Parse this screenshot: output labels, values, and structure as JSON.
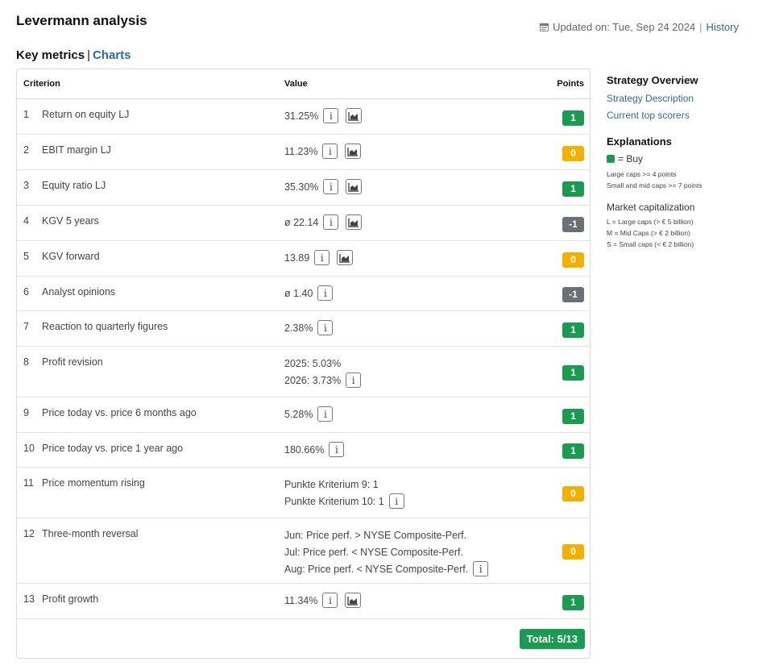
{
  "header": {
    "title": "Levermann analysis",
    "updated": "Updated on: Tue, Sep 24 2024",
    "separator": "|",
    "history": "History"
  },
  "subheader": {
    "key_metrics": "Key metrics",
    "separator": "|",
    "charts": "Charts"
  },
  "table": {
    "headers": {
      "criterion": "Criterion",
      "value": "Value",
      "points": "Points"
    },
    "rows": [
      {
        "num": "1",
        "label": "Return on equity LJ",
        "lines": [
          "31.25%"
        ],
        "chart": true,
        "points": "1",
        "color": "green"
      },
      {
        "num": "2",
        "label": "EBIT margin LJ",
        "lines": [
          "11.23%"
        ],
        "chart": true,
        "points": "0",
        "color": "yellow"
      },
      {
        "num": "3",
        "label": "Equity ratio LJ",
        "lines": [
          "35.30%"
        ],
        "chart": true,
        "points": "1",
        "color": "green"
      },
      {
        "num": "4",
        "label": "KGV 5 years",
        "lines": [
          "ø 22.14"
        ],
        "chart": true,
        "points": "-1",
        "color": "gray"
      },
      {
        "num": "5",
        "label": "KGV forward",
        "lines": [
          "13.89"
        ],
        "chart": true,
        "points": "0",
        "color": "yellow"
      },
      {
        "num": "6",
        "label": "Analyst opinions",
        "lines": [
          "ø 1.40"
        ],
        "chart": false,
        "points": "-1",
        "color": "gray"
      },
      {
        "num": "7",
        "label": "Reaction to quarterly figures",
        "lines": [
          "2.38%"
        ],
        "chart": false,
        "points": "1",
        "color": "green"
      },
      {
        "num": "8",
        "label": "Profit revision",
        "lines": [
          "2025: 5.03%",
          "2026: 3.73%"
        ],
        "chart": false,
        "points": "1",
        "color": "green"
      },
      {
        "num": "9",
        "label": "Price today vs. price 6 months ago",
        "lines": [
          "5.28%"
        ],
        "chart": false,
        "points": "1",
        "color": "green"
      },
      {
        "num": "10",
        "label": "Price today vs. price 1 year ago",
        "lines": [
          "180.66%"
        ],
        "chart": false,
        "points": "1",
        "color": "green"
      },
      {
        "num": "11",
        "label": "Price momentum rising",
        "lines": [
          "Punkte Kriterium 9: 1",
          "Punkte Kriterium 10: 1"
        ],
        "chart": false,
        "points": "0",
        "color": "yellow"
      },
      {
        "num": "12",
        "label": "Three-month reversal",
        "lines": [
          "Jun: Price perf. > NYSE Composite-Perf.",
          "Jul: Price perf. < NYSE Composite-Perf.",
          "Aug: Price perf. < NYSE Composite-Perf."
        ],
        "chart": false,
        "points": "0",
        "color": "yellow"
      },
      {
        "num": "13",
        "label": "Profit growth",
        "lines": [
          "11.34%"
        ],
        "chart": true,
        "points": "1",
        "color": "green"
      }
    ],
    "total": "Total: 5/13"
  },
  "sidebar": {
    "strategy_title": "Strategy Overview",
    "strategy_description": "Strategy Description",
    "current_top_scorers": "Current top scorers",
    "explanations_title": "Explanations",
    "buy_legend": "= Buy",
    "large_caps_rule": "Large caps >= 4 points",
    "small_mid_caps_rule": "Small and mid caps >= 7 points",
    "market_cap_title": "Market capitalization",
    "cap_l": "L = Large caps (> € 5 billion)",
    "cap_m": "M = Mid Caps (> € 2 billion)",
    "cap_s": "S = Small caps (< € 2 billion)"
  },
  "colors": {
    "green": "#1c9a52",
    "yellow": "#f4b000",
    "gray": "#6b7075",
    "link": "#2d6a9f"
  },
  "icons": {
    "info": "info-icon",
    "chart": "chart-icon",
    "calendar": "calendar-icon"
  }
}
